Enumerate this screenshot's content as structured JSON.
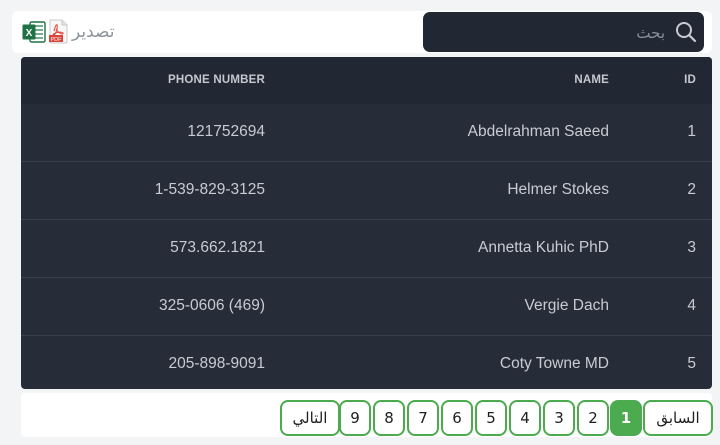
{
  "toolbar": {
    "export_label": "تصدير",
    "search_placeholder": "بحث",
    "search_value": ""
  },
  "table": {
    "headers": {
      "id": "ID",
      "name": "NAME",
      "phone": "PHONE NUMBER"
    },
    "rows": [
      {
        "id": "1",
        "name": "Abdelrahman Saeed",
        "phone": "121752694"
      },
      {
        "id": "2",
        "name": "Helmer Stokes",
        "phone": "1-539-829-3125"
      },
      {
        "id": "3",
        "name": "Annetta Kuhic PhD",
        "phone": "573.662.1821"
      },
      {
        "id": "4",
        "name": "Vergie Dach",
        "phone": "325-0606 (469)"
      },
      {
        "id": "5",
        "name": "Coty Towne MD",
        "phone": "205-898-9091"
      }
    ]
  },
  "pagination": {
    "prev_label": "السابق",
    "next_label": "التالي",
    "pages": [
      "1",
      "2",
      "3",
      "4",
      "5",
      "6",
      "7",
      "8",
      "9"
    ],
    "current": "1"
  },
  "colors": {
    "accent": "#4caa4f",
    "table_bg": "#272d38",
    "header_bg": "#222833"
  }
}
